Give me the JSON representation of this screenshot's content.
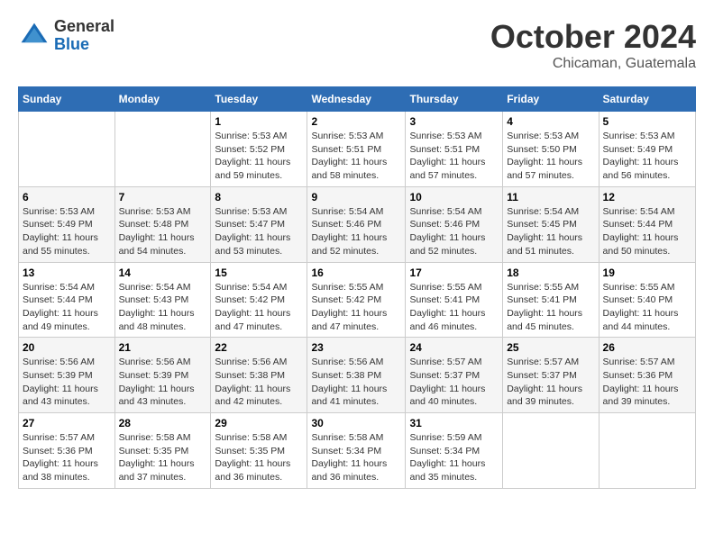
{
  "logo": {
    "general": "General",
    "blue": "Blue"
  },
  "header": {
    "month": "October 2024",
    "location": "Chicaman, Guatemala"
  },
  "weekdays": [
    "Sunday",
    "Monday",
    "Tuesday",
    "Wednesday",
    "Thursday",
    "Friday",
    "Saturday"
  ],
  "weeks": [
    [
      {
        "day": "",
        "sunrise": "",
        "sunset": "",
        "daylight": ""
      },
      {
        "day": "",
        "sunrise": "",
        "sunset": "",
        "daylight": ""
      },
      {
        "day": "1",
        "sunrise": "Sunrise: 5:53 AM",
        "sunset": "Sunset: 5:52 PM",
        "daylight": "Daylight: 11 hours and 59 minutes."
      },
      {
        "day": "2",
        "sunrise": "Sunrise: 5:53 AM",
        "sunset": "Sunset: 5:51 PM",
        "daylight": "Daylight: 11 hours and 58 minutes."
      },
      {
        "day": "3",
        "sunrise": "Sunrise: 5:53 AM",
        "sunset": "Sunset: 5:51 PM",
        "daylight": "Daylight: 11 hours and 57 minutes."
      },
      {
        "day": "4",
        "sunrise": "Sunrise: 5:53 AM",
        "sunset": "Sunset: 5:50 PM",
        "daylight": "Daylight: 11 hours and 57 minutes."
      },
      {
        "day": "5",
        "sunrise": "Sunrise: 5:53 AM",
        "sunset": "Sunset: 5:49 PM",
        "daylight": "Daylight: 11 hours and 56 minutes."
      }
    ],
    [
      {
        "day": "6",
        "sunrise": "Sunrise: 5:53 AM",
        "sunset": "Sunset: 5:49 PM",
        "daylight": "Daylight: 11 hours and 55 minutes."
      },
      {
        "day": "7",
        "sunrise": "Sunrise: 5:53 AM",
        "sunset": "Sunset: 5:48 PM",
        "daylight": "Daylight: 11 hours and 54 minutes."
      },
      {
        "day": "8",
        "sunrise": "Sunrise: 5:53 AM",
        "sunset": "Sunset: 5:47 PM",
        "daylight": "Daylight: 11 hours and 53 minutes."
      },
      {
        "day": "9",
        "sunrise": "Sunrise: 5:54 AM",
        "sunset": "Sunset: 5:46 PM",
        "daylight": "Daylight: 11 hours and 52 minutes."
      },
      {
        "day": "10",
        "sunrise": "Sunrise: 5:54 AM",
        "sunset": "Sunset: 5:46 PM",
        "daylight": "Daylight: 11 hours and 52 minutes."
      },
      {
        "day": "11",
        "sunrise": "Sunrise: 5:54 AM",
        "sunset": "Sunset: 5:45 PM",
        "daylight": "Daylight: 11 hours and 51 minutes."
      },
      {
        "day": "12",
        "sunrise": "Sunrise: 5:54 AM",
        "sunset": "Sunset: 5:44 PM",
        "daylight": "Daylight: 11 hours and 50 minutes."
      }
    ],
    [
      {
        "day": "13",
        "sunrise": "Sunrise: 5:54 AM",
        "sunset": "Sunset: 5:44 PM",
        "daylight": "Daylight: 11 hours and 49 minutes."
      },
      {
        "day": "14",
        "sunrise": "Sunrise: 5:54 AM",
        "sunset": "Sunset: 5:43 PM",
        "daylight": "Daylight: 11 hours and 48 minutes."
      },
      {
        "day": "15",
        "sunrise": "Sunrise: 5:54 AM",
        "sunset": "Sunset: 5:42 PM",
        "daylight": "Daylight: 11 hours and 47 minutes."
      },
      {
        "day": "16",
        "sunrise": "Sunrise: 5:55 AM",
        "sunset": "Sunset: 5:42 PM",
        "daylight": "Daylight: 11 hours and 47 minutes."
      },
      {
        "day": "17",
        "sunrise": "Sunrise: 5:55 AM",
        "sunset": "Sunset: 5:41 PM",
        "daylight": "Daylight: 11 hours and 46 minutes."
      },
      {
        "day": "18",
        "sunrise": "Sunrise: 5:55 AM",
        "sunset": "Sunset: 5:41 PM",
        "daylight": "Daylight: 11 hours and 45 minutes."
      },
      {
        "day": "19",
        "sunrise": "Sunrise: 5:55 AM",
        "sunset": "Sunset: 5:40 PM",
        "daylight": "Daylight: 11 hours and 44 minutes."
      }
    ],
    [
      {
        "day": "20",
        "sunrise": "Sunrise: 5:56 AM",
        "sunset": "Sunset: 5:39 PM",
        "daylight": "Daylight: 11 hours and 43 minutes."
      },
      {
        "day": "21",
        "sunrise": "Sunrise: 5:56 AM",
        "sunset": "Sunset: 5:39 PM",
        "daylight": "Daylight: 11 hours and 43 minutes."
      },
      {
        "day": "22",
        "sunrise": "Sunrise: 5:56 AM",
        "sunset": "Sunset: 5:38 PM",
        "daylight": "Daylight: 11 hours and 42 minutes."
      },
      {
        "day": "23",
        "sunrise": "Sunrise: 5:56 AM",
        "sunset": "Sunset: 5:38 PM",
        "daylight": "Daylight: 11 hours and 41 minutes."
      },
      {
        "day": "24",
        "sunrise": "Sunrise: 5:57 AM",
        "sunset": "Sunset: 5:37 PM",
        "daylight": "Daylight: 11 hours and 40 minutes."
      },
      {
        "day": "25",
        "sunrise": "Sunrise: 5:57 AM",
        "sunset": "Sunset: 5:37 PM",
        "daylight": "Daylight: 11 hours and 39 minutes."
      },
      {
        "day": "26",
        "sunrise": "Sunrise: 5:57 AM",
        "sunset": "Sunset: 5:36 PM",
        "daylight": "Daylight: 11 hours and 39 minutes."
      }
    ],
    [
      {
        "day": "27",
        "sunrise": "Sunrise: 5:57 AM",
        "sunset": "Sunset: 5:36 PM",
        "daylight": "Daylight: 11 hours and 38 minutes."
      },
      {
        "day": "28",
        "sunrise": "Sunrise: 5:58 AM",
        "sunset": "Sunset: 5:35 PM",
        "daylight": "Daylight: 11 hours and 37 minutes."
      },
      {
        "day": "29",
        "sunrise": "Sunrise: 5:58 AM",
        "sunset": "Sunset: 5:35 PM",
        "daylight": "Daylight: 11 hours and 36 minutes."
      },
      {
        "day": "30",
        "sunrise": "Sunrise: 5:58 AM",
        "sunset": "Sunset: 5:34 PM",
        "daylight": "Daylight: 11 hours and 36 minutes."
      },
      {
        "day": "31",
        "sunrise": "Sunrise: 5:59 AM",
        "sunset": "Sunset: 5:34 PM",
        "daylight": "Daylight: 11 hours and 35 minutes."
      },
      {
        "day": "",
        "sunrise": "",
        "sunset": "",
        "daylight": ""
      },
      {
        "day": "",
        "sunrise": "",
        "sunset": "",
        "daylight": ""
      }
    ]
  ]
}
